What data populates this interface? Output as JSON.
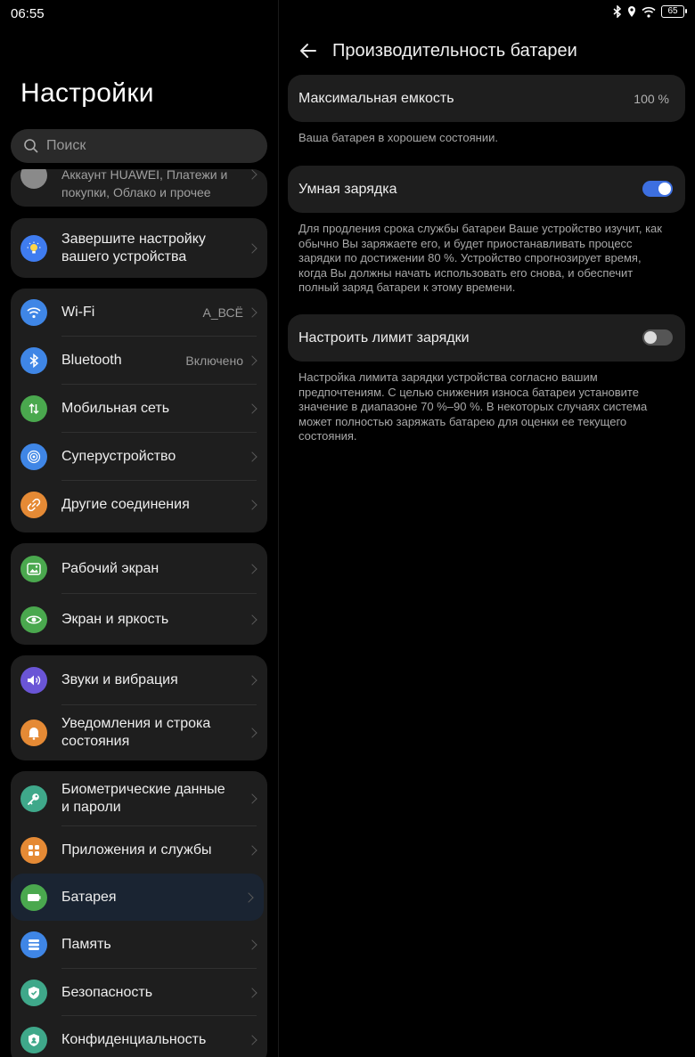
{
  "status_bar": {
    "time": "06:55",
    "battery": "65",
    "icons": [
      "bluetooth-icon",
      "location-icon",
      "wifi-icon",
      "battery-icon"
    ]
  },
  "left": {
    "title": "Настройки",
    "search_placeholder": "Поиск",
    "account": {
      "subtitle": "Аккаунт HUAWEI, Платежи и покупки, Облако и прочее"
    },
    "setup": {
      "label": "Завершите настройку вашего устройства",
      "icon": "lightbulb-icon",
      "color": "#3f7cf0"
    },
    "group1": [
      {
        "label": "Wi-Fi",
        "value": "A_ВСЁ",
        "icon": "wifi-icon",
        "color": "#3f86e6"
      },
      {
        "label": "Bluetooth",
        "value": "Включено",
        "icon": "bluetooth-icon",
        "color": "#3f86e6"
      },
      {
        "label": "Мобильная сеть",
        "value": "",
        "icon": "mobile-data-icon",
        "color": "#4aa84e"
      },
      {
        "label": "Суперустройство",
        "value": "",
        "icon": "superdevice-icon",
        "color": "#3f86e6"
      },
      {
        "label": "Другие соединения",
        "value": "",
        "icon": "link-icon",
        "color": "#e58a35"
      }
    ],
    "group2": [
      {
        "label": "Рабочий экран",
        "icon": "home-screen-icon",
        "color": "#4aa84e"
      },
      {
        "label": "Экран и яркость",
        "icon": "eye-icon",
        "color": "#4aa84e"
      }
    ],
    "group3": [
      {
        "label": "Звуки и вибрация",
        "icon": "sound-icon",
        "color": "#6a55d6"
      },
      {
        "label": "Уведомления и строка состояния",
        "icon": "bell-icon",
        "color": "#e58a35"
      }
    ],
    "group4": [
      {
        "label": "Биометрические данные и пароли",
        "icon": "key-icon",
        "color": "#3fa88a"
      },
      {
        "label": "Приложения и службы",
        "icon": "apps-icon",
        "color": "#e58a35"
      },
      {
        "label": "Батарея",
        "icon": "battery-icon",
        "color": "#4aa84e"
      },
      {
        "label": "Память",
        "icon": "storage-icon",
        "color": "#3f86e6"
      },
      {
        "label": "Безопасность",
        "icon": "shield-icon",
        "color": "#3fa88a"
      },
      {
        "label": "Конфиденциальность",
        "icon": "privacy-icon",
        "color": "#3fa88a"
      }
    ]
  },
  "right": {
    "title": "Производительность батареи",
    "max_capacity": {
      "label": "Максимальная емкость",
      "value": "100 %"
    },
    "capacity_note": "Ваша батарея в хорошем состоянии.",
    "smart_charging": {
      "label": "Умная зарядка",
      "enabled": true
    },
    "smart_note": "Для продления срока службы батареи Ваше устройство изучит, как обычно Вы заряжаете его, и будет приостанавливать процесс зарядки по достижении 80 %. Устройство спрогнозирует время, когда Вы должны начать использовать его снова, и обеспечит полный заряд батареи к этому времени.",
    "charge_limit": {
      "label": "Настроить лимит зарядки",
      "enabled": false
    },
    "limit_note": "Настройка лимита зарядки устройства согласно вашим предпочтениям. С целью снижения износа батареи установите значение в диапазоне 70 %–90 %. В некоторых случаях система может полностью заряжать батарею для оценки ее текущего состояния."
  }
}
